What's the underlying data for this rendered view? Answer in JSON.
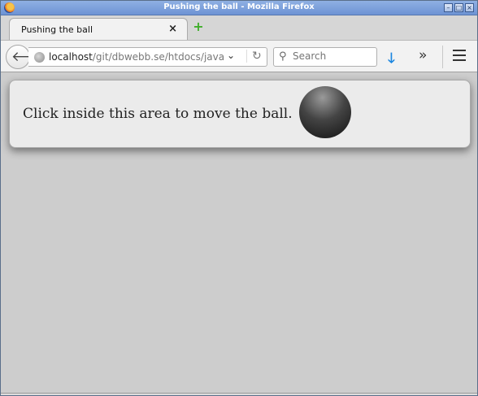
{
  "window": {
    "title": "Pushing the ball - Mozilla Firefox",
    "controls": [
      "minimize-icon",
      "maximize-icon",
      "close-icon"
    ]
  },
  "tab": {
    "label": "Pushing the ball",
    "close_glyph": "×",
    "new_tab_glyph": "+"
  },
  "navbar": {
    "url_host": "localhost",
    "url_path": "/git/dbwebb.se/htdocs/javas",
    "search_placeholder": "Search",
    "overflow_glyph": "»"
  },
  "page": {
    "message": "Click inside this area to move the ball."
  },
  "colors": {
    "titlebar": "#7a9edb",
    "content_bg": "#cdcdcd",
    "area_bg": "#ebebeb",
    "ball": "#333333",
    "download_arrow": "#1b86e0",
    "new_tab_plus": "#3fae2a"
  }
}
